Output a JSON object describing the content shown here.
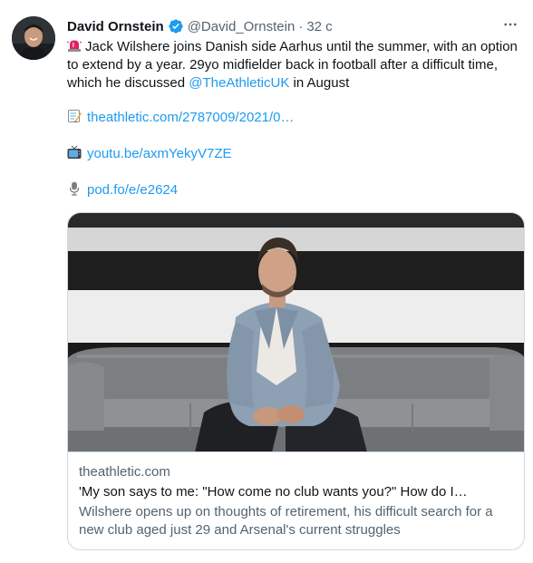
{
  "author": {
    "name": "David Ornstein",
    "handle": "@David_Ornstein",
    "separator": "·",
    "time": "32 с"
  },
  "icons": {
    "more": "more-horizontal-icon",
    "verified": "verified-badge-icon",
    "siren": "rotating-light-icon",
    "memo": "memo-icon",
    "tv": "television-icon",
    "mic": "microphone-icon"
  },
  "tweet": {
    "text_main": "Jack Wilshere joins Danish side Aarhus until the summer, with an option to extend by a year. 29yo midfielder back in football after a difficult time, which he discussed ",
    "mention": "@TheAthleticUK",
    "text_tail": " in August",
    "links": [
      {
        "text": "theathletic.com/2787009/2021/0…"
      },
      {
        "text": "youtu.be/axmYekyV7ZE"
      },
      {
        "text": "pod.fo/e/e2624"
      }
    ]
  },
  "card": {
    "domain": "theathletic.com",
    "title": "'My son says to me: \"How come no club wants you?\" How do I…",
    "description": "Wilshere opens up on thoughts of retirement, his difficult search for a new club aged just 29 and Arsenal's current struggles"
  },
  "colors": {
    "link": "#1d9bf0",
    "secondary_text": "#536471",
    "border": "#cfd9de",
    "verified": "#1d9bf0"
  }
}
